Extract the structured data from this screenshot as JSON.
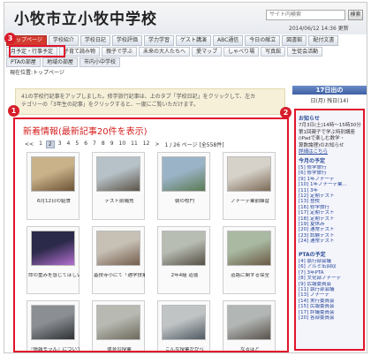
{
  "site": {
    "title": "小牧市立小牧中学校",
    "search_placeholder": "サイト内検索",
    "search_button": "検索",
    "date": "2014/06/12 14:36 更新"
  },
  "nav_row1": [
    "トップページ",
    "学校紹介",
    "学校日記",
    "学校評価",
    "学力学習",
    "ゲスト講演",
    "ABC通信",
    "今日の献立",
    "図書館",
    "配付文書"
  ],
  "nav_row2": [
    "月予定・行事予定",
    "子育て読み物",
    "親子で学ぶ",
    "未来の大人たちへ",
    "愛マップ",
    "しゃべり場",
    "写真館",
    "生徒会活動"
  ],
  "nav_row3": [
    "PTAの部屋",
    "地域の部屋",
    "市内小中学校"
  ],
  "breadcrumb": "現在位置:トップページ",
  "notice": {
    "line1": "41の学校行記事をアップしました。修学旅行記事は、上のタブ「学校日記」をクリックして、左カ",
    "line2": "テゴリーの「3年生の記事」をクリックすると、一度にご覧いただけます。"
  },
  "badges": [
    "3",
    "1",
    "2"
  ],
  "main": {
    "title": "新着情報(最新記事20件を表示)",
    "pager": {
      "prev": "<<",
      "pages": [
        "1",
        "2",
        "3",
        "4",
        "5",
        "6",
        "7",
        "8",
        "9",
        "10",
        "11",
        "12"
      ],
      "current": "2",
      "next": ">",
      "summary": "1 / 26 ページ [全558件]"
    },
    "thumbnails": [
      {
        "caption": "6月12日の給食",
        "color1": "#c9b28a",
        "color2": "#6b5236"
      },
      {
        "caption": "テスト前補充",
        "color1": "#b7c2c8",
        "color2": "#5d5447"
      },
      {
        "caption": "朝の校門",
        "color1": "#9bb3c7",
        "color2": "#5a7a52"
      },
      {
        "caption": "ノナーデ業前練習",
        "color1": "#d6d2c9",
        "color2": "#7d6a57"
      },
      {
        "caption": "命の重みを感じてほしい",
        "color1": "#2c2a4a",
        "color2": "#b36fd0"
      },
      {
        "caption": "基技寺小にて「通学技業の見方」講演",
        "color1": "#c7c0b5",
        "color2": "#745e4c"
      },
      {
        "caption": "2年4組 道徳",
        "color1": "#b8bdb3",
        "color2": "#564f45"
      },
      {
        "caption": "道路に関する保全",
        "color1": "#a9b9a2",
        "color2": "#6a5a44"
      },
      {
        "caption": "『情報モラル』についての",
        "color1": "#8b8f93",
        "color2": "#2f3134"
      },
      {
        "caption": "体育の授業",
        "color1": "#b7b9b2",
        "color2": "#6e6a5b"
      },
      {
        "caption": "こんな授業がから",
        "color1": "#c0c4c5",
        "color2": "#4f5a63"
      },
      {
        "caption": "なるほど",
        "color1": "#b2b6b4",
        "color2": "#59514b"
      }
    ]
  },
  "sidebar": {
    "head": "17日出の",
    "date": "日(月) 残日(14)",
    "section_notice": "お知らせ",
    "notice_text": [
      "7月3日(土)14時～15時30分",
      "第1回親子で学ぶ特別講座(iPadで楽しむ数学・",
      "算数論理)のお知らせ"
    ],
    "notice_link": "詳細はこちら",
    "section_month": "今月の予定",
    "month_items": [
      "[5] 修学旅行",
      "[6] 修学旅行",
      "[9] 1年ノナーデ",
      "[10] 1年ノナーデ業...",
      "[11] 3年",
      "[12] 定期テスト",
      "[13] 登校",
      "[16] 修学旅行",
      "[17] 定期テスト",
      "[18] 定期テスト",
      "[19] 夏休み",
      "[20] 通常テスト",
      "[23] 試験テスト",
      "[24] 通常テスト"
    ],
    "section_pta": "PTAの予定",
    "pta_items": [
      "[4] 執行部会議",
      "[6] アルミ缶回収",
      "[7] 3年PTA",
      "[8] 文化部ノナーデ",
      "[9] 広報委員会",
      "[11] 執行部会議",
      "[13] ノナーデ",
      "[14] 実行委員会",
      "[15] 広報委員会",
      "[17] 評議委員会",
      "[20] 各部委員会"
    ]
  }
}
